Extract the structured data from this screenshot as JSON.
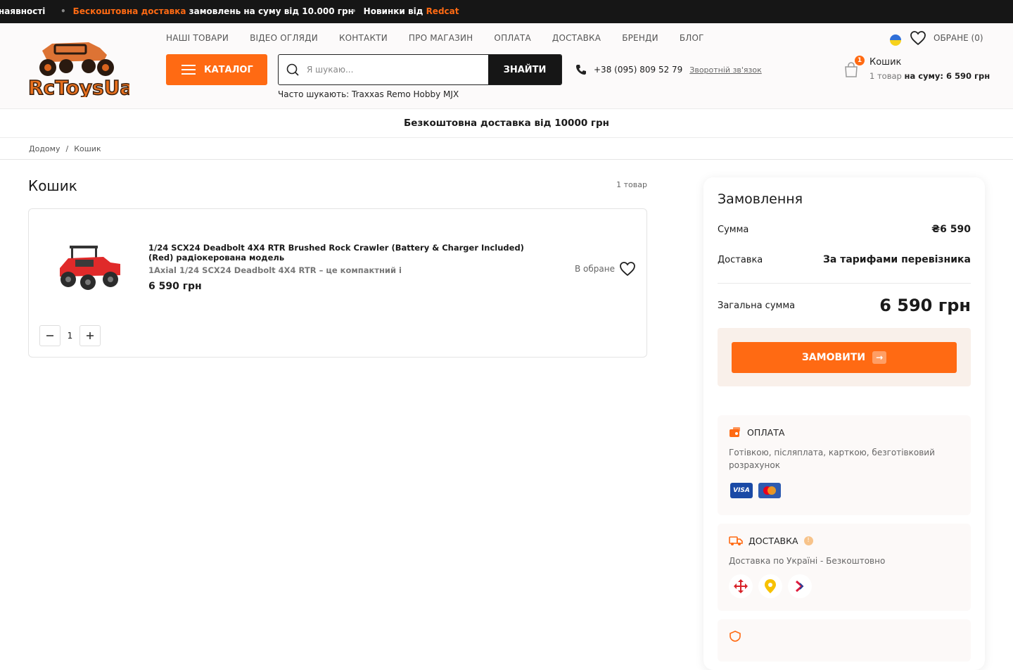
{
  "ticker": {
    "item1": "наявності",
    "item2_accent": "Бескоштовна доставка",
    "item2_rest": " замовлень на суму від 10.000 грн",
    "item3_text": "Новинки від ",
    "item3_accent": "Redcat"
  },
  "header": {
    "logo_text": "RcToysUa",
    "nav": [
      "НАШІ ТОВАРИ",
      "ВІДЕО ОГЛЯДИ",
      "КОНТАКТИ",
      "ПРО МАГАЗИН",
      "ОПЛАТА",
      "ДОСТАВКА",
      "БРЕНДИ",
      "БЛОГ"
    ],
    "catalog_label": "КАТАЛОГ",
    "search_placeholder": "Я шукаю...",
    "search_button": "ЗНАЙТИ",
    "often_searched": "Часто шукають: Traxxas Remo Hobby MJX",
    "phone": "+38 (095) 809 52 79",
    "callback": "Зворотній зв'язок",
    "favorites": "ОБРАНЕ (0)",
    "cart_badge": "1",
    "cart_label": "Кошик",
    "cart_count": "1 товар ",
    "cart_sum": "на суму: 6 590 грн"
  },
  "promo": "Безкоштовна доставка від 10000 грн",
  "breadcrumb": {
    "home": "Додому",
    "sep": "/",
    "current": "Кошик"
  },
  "cart": {
    "title": "Кошик",
    "count": "1 товар",
    "item": {
      "name": "1/24 SCX24 Deadbolt 4X4 RTR Brushed Rock Crawler (Battery & Charger Included) (Red) радіокерована модель",
      "desc": "1Axial 1/24 SCX24 Deadbolt 4X4 RTR – це компактний і",
      "price": "6 590 грн",
      "fav_label": "В обране",
      "qty": "1"
    }
  },
  "order": {
    "title": "Замовлення",
    "sum_label": "Сумма",
    "sum_value": "₴6 590",
    "delivery_label": "Доставка",
    "delivery_value": "За тарифами перевізника",
    "total_label": "Загальна сумма",
    "total_value": "6 590 грн",
    "button": "ЗАМОВИТИ",
    "payment_title": "ОПЛАТА",
    "payment_text": "Готівкою, післяплата, карткою, безготівковий розрахунок",
    "visa": "VISA",
    "shipping_title": "ДОСТАВКА",
    "shipping_text": "Доставка по Україні - Безкоштовно",
    "shipping_warn": "!"
  },
  "colors": {
    "accent": "#ff6a13",
    "dark": "#161616"
  }
}
